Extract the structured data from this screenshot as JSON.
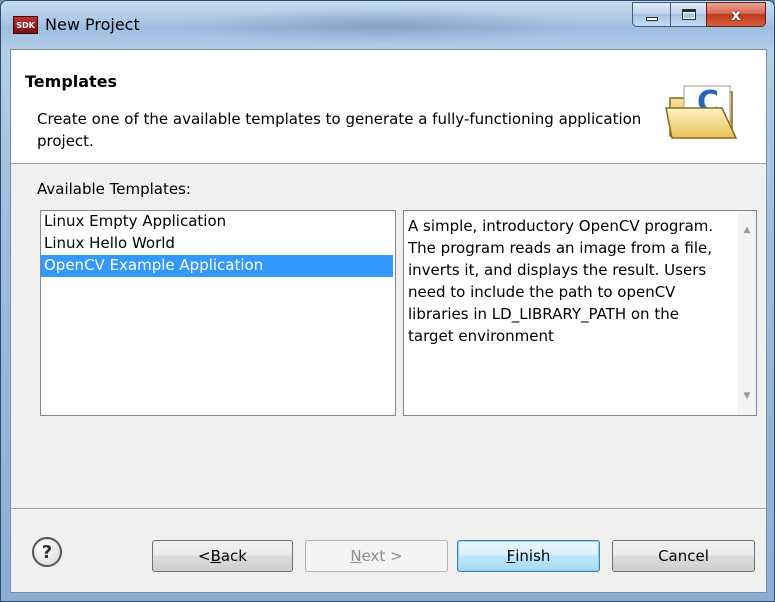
{
  "window": {
    "title": "New Project",
    "app_icon_text": "SDK",
    "close_glyph": "x"
  },
  "banner": {
    "title": "Templates",
    "description": "Create one of the available templates to generate a fully-functioning application project.",
    "icon": "folder-c-icon"
  },
  "templates": {
    "label": "Available Templates:",
    "items": [
      {
        "label": "Linux Empty Application",
        "selected": false
      },
      {
        "label": "Linux Hello World",
        "selected": false
      },
      {
        "label": "OpenCV Example Application",
        "selected": true
      }
    ],
    "description": "A simple, introductory OpenCV program. The program reads an image from a file, inverts it, and displays the result.  Users need to include the path to openCV libraries in  LD_LIBRARY_PATH on the target environment"
  },
  "buttons": {
    "help": "?",
    "back_prefix": "< ",
    "back_mnemonic": "B",
    "back_rest": "ack",
    "next_mnemonic": "N",
    "next_rest": "ext >",
    "finish_mnemonic": "F",
    "finish_rest": "inish",
    "cancel": "Cancel"
  },
  "colors": {
    "selection": "#3399ff",
    "default_button_border": "#3c7fb1"
  }
}
